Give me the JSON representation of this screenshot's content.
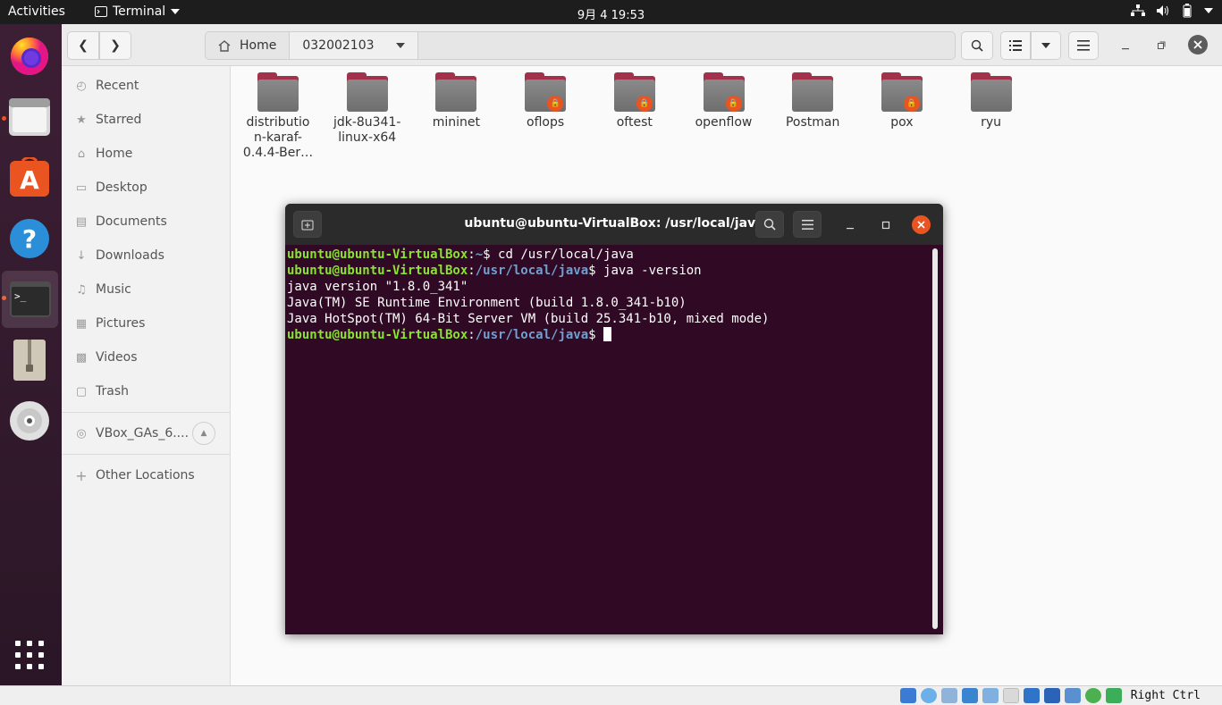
{
  "topbar": {
    "activities": "Activities",
    "app_menu": "Terminal",
    "clock": "9月 4  19:53"
  },
  "dock": {
    "items": [
      "firefox-icon",
      "files-icon",
      "software-icon",
      "help-icon",
      "terminal-icon",
      "archive-icon",
      "disc-icon",
      "show-apps-icon"
    ],
    "terminal_prompt_glyph": ">_"
  },
  "files": {
    "path": {
      "home": "Home",
      "current": "032002103"
    },
    "sidebar": [
      {
        "label": "Recent",
        "icon": "clock-icon"
      },
      {
        "label": "Starred",
        "icon": "star-icon"
      },
      {
        "label": "Home",
        "icon": "home-icon"
      },
      {
        "label": "Desktop",
        "icon": "desktop-icon"
      },
      {
        "label": "Documents",
        "icon": "documents-icon"
      },
      {
        "label": "Downloads",
        "icon": "downloads-icon"
      },
      {
        "label": "Music",
        "icon": "music-icon"
      },
      {
        "label": "Pictures",
        "icon": "pictures-icon"
      },
      {
        "label": "Videos",
        "icon": "videos-icon"
      },
      {
        "label": "Trash",
        "icon": "trash-icon"
      }
    ],
    "device": {
      "label": "VBox_GAs_6....",
      "icon": "disc-icon"
    },
    "other": {
      "label": "Other Locations",
      "icon": "plus-icon"
    },
    "folders": [
      {
        "line1": "distributio",
        "line2": "n-karaf-",
        "line3": "0.4.4-Ber…",
        "locked": false
      },
      {
        "line1": "jdk-8u341-",
        "line2": "linux-x64",
        "line3": "",
        "locked": false
      },
      {
        "line1": "mininet",
        "line2": "",
        "line3": "",
        "locked": false
      },
      {
        "line1": "oflops",
        "line2": "",
        "line3": "",
        "locked": true
      },
      {
        "line1": "oftest",
        "line2": "",
        "line3": "",
        "locked": true
      },
      {
        "line1": "openflow",
        "line2": "",
        "line3": "",
        "locked": true
      },
      {
        "line1": "Postman",
        "line2": "",
        "line3": "",
        "locked": false
      },
      {
        "line1": "pox",
        "line2": "",
        "line3": "",
        "locked": true
      },
      {
        "line1": "ryu",
        "line2": "",
        "line3": "",
        "locked": false
      }
    ]
  },
  "terminal": {
    "title": "ubuntu@ubuntu-VirtualBox: /usr/local/java",
    "lines": [
      {
        "user": "ubuntu@ubuntu-VirtualBox",
        "sep": ":",
        "path": "~",
        "cmd": "$ cd /usr/local/java"
      },
      {
        "user": "ubuntu@ubuntu-VirtualBox",
        "sep": ":",
        "path": "/usr/local/java",
        "cmd": "$ java -version"
      },
      {
        "out": "java version \"1.8.0_341\""
      },
      {
        "out": "Java(TM) SE Runtime Environment (build 1.8.0_341-b10)"
      },
      {
        "out": "Java HotSpot(TM) 64-Bit Server VM (build 25.341-b10, mixed mode)"
      },
      {
        "user": "ubuntu@ubuntu-VirtualBox",
        "sep": ":",
        "path": "/usr/local/java",
        "cmd": "$ "
      }
    ]
  },
  "vbox": {
    "host_key": "Right Ctrl"
  },
  "colors": {
    "accent": "#e95420",
    "terminal_bg": "#300a24",
    "prompt_user": "#8ae234",
    "prompt_path": "#729fcf"
  }
}
